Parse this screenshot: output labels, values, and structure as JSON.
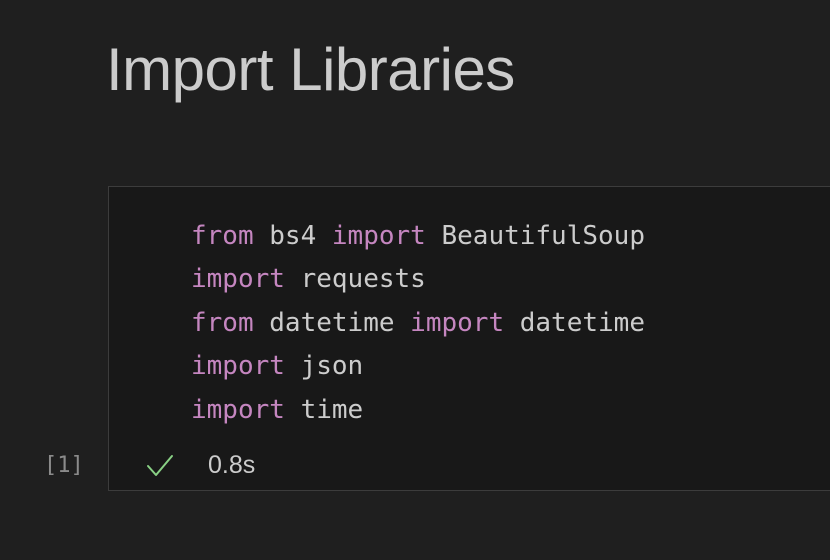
{
  "markdown_cell": {
    "heading": "Import Libraries"
  },
  "code_cell": {
    "execution_count": "[1]",
    "lines": [
      [
        {
          "t": "from",
          "kw": true
        },
        {
          "t": " bs4 ",
          "kw": false
        },
        {
          "t": "import",
          "kw": true
        },
        {
          "t": " BeautifulSoup",
          "kw": false
        }
      ],
      [
        {
          "t": "import",
          "kw": true
        },
        {
          "t": " requests",
          "kw": false
        }
      ],
      [
        {
          "t": "from",
          "kw": true
        },
        {
          "t": " datetime ",
          "kw": false
        },
        {
          "t": "import",
          "kw": true
        },
        {
          "t": " datetime",
          "kw": false
        }
      ],
      [
        {
          "t": "import",
          "kw": true
        },
        {
          "t": " json",
          "kw": false
        }
      ],
      [
        {
          "t": "import",
          "kw": true
        },
        {
          "t": " time",
          "kw": false
        }
      ]
    ],
    "status": {
      "icon": "check-icon",
      "duration": "0.8s"
    }
  },
  "colors": {
    "background": "#1f1f1f",
    "cell_background": "#181818",
    "cell_border": "#3c3c3c",
    "text": "#cccccc",
    "keyword": "#c586c0",
    "success": "#89d185",
    "execution_count": "#8b8b8b"
  }
}
